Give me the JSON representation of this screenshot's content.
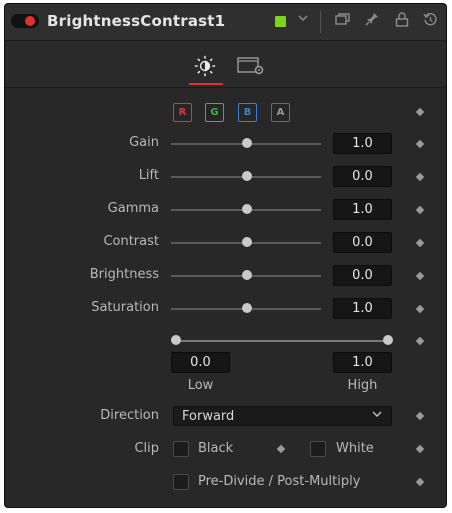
{
  "header": {
    "title": "BrightnessContrast1",
    "swatch_color": "#7fd21d",
    "icons": [
      "chevron-down-icon",
      "copy-icon",
      "pin-icon",
      "lock-icon",
      "reset-icon"
    ]
  },
  "tabs": [
    {
      "name": "controls-tab",
      "icon": "brightness-icon",
      "active": true
    },
    {
      "name": "settings-tab",
      "icon": "settings-icon",
      "active": false
    }
  ],
  "channels": [
    {
      "label": "R",
      "color": "#d43a3a"
    },
    {
      "label": "G",
      "color": "#3db34a"
    },
    {
      "label": "B",
      "color": "#3d7fd6"
    },
    {
      "label": "A",
      "color": "#9a9a9a"
    }
  ],
  "params": [
    {
      "label": "Gain",
      "value": "1.0",
      "level": 0.5
    },
    {
      "label": "Lift",
      "value": "0.0",
      "level": 0.5
    },
    {
      "label": "Gamma",
      "value": "1.0",
      "level": 0.5
    },
    {
      "label": "Contrast",
      "value": "0.0",
      "level": 0.5
    },
    {
      "label": "Brightness",
      "value": "0.0",
      "level": 0.5
    },
    {
      "label": "Saturation",
      "value": "1.0",
      "level": 0.5
    }
  ],
  "range": {
    "low_value": "0.0",
    "high_value": "1.0",
    "low_label": "Low",
    "high_label": "High"
  },
  "direction": {
    "label": "Direction",
    "value": "Forward"
  },
  "clip": {
    "label": "Clip",
    "black_label": "Black",
    "white_label": "White"
  },
  "predivide_label": "Pre-Divide / Post-Multiply"
}
